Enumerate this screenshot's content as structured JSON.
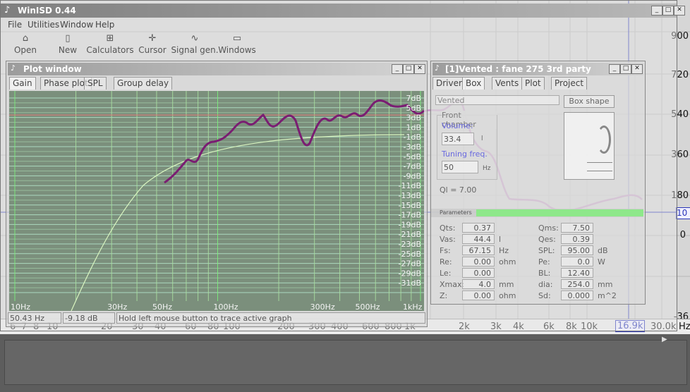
{
  "app": {
    "title": "WinISD 0.44",
    "menu": [
      "File",
      "Utilities",
      "Window",
      "Help"
    ],
    "toolbar": [
      {
        "label": "Open",
        "icon": "open-folder-icon"
      },
      {
        "label": "New",
        "icon": "new-document-icon"
      },
      {
        "label": "Calculators",
        "icon": "calculator-icon"
      },
      {
        "label": "Cursor",
        "icon": "cursor-icon"
      },
      {
        "label": "Signal gen.",
        "icon": "signal-generator-icon"
      },
      {
        "label": "Windows",
        "icon": "windows-icon"
      }
    ]
  },
  "background_graph": {
    "freq_labels": [
      "6",
      "7",
      "8",
      "10",
      "20",
      "30",
      "40",
      "60",
      "80",
      "100",
      "200",
      "300",
      "400",
      "600",
      "800",
      "1k",
      "2k",
      "3k",
      "4k",
      "6k",
      "8k",
      "10k",
      "16.9k",
      "30.0k",
      "Hz"
    ],
    "right_labels": [
      "900",
      "720",
      "540",
      "360",
      "180",
      "0",
      "-36",
      "10"
    ],
    "cursor_readout": "16.9k"
  },
  "plot_window": {
    "title": "Plot window",
    "tabs": [
      "Gain",
      "Phase plot",
      "SPL",
      "Group delay"
    ],
    "db_labels": [
      "7dB",
      "5dB",
      "3dB",
      "1dB",
      "-1dB",
      "-3dB",
      "-5dB",
      "-7dB",
      "-9dB",
      "-11dB",
      "-13dB",
      "-15dB",
      "-17dB",
      "-19dB",
      "-21dB",
      "-23dB",
      "-25dB",
      "-27dB",
      "-29dB",
      "-31dB"
    ],
    "freq_labels": [
      "10Hz",
      "30Hz",
      "50Hz",
      "100Hz",
      "300Hz",
      "500Hz",
      "1kHz"
    ],
    "status": {
      "freq": "50.43 Hz",
      "gain": "-9.18 dB",
      "hint": "Hold left mouse button to trace active graph"
    }
  },
  "box_window": {
    "title": "[1]Vented : fane 275 3rd party",
    "tabs": [
      "Driver",
      "Box",
      "Vents",
      "Plot",
      "Project"
    ],
    "box_type": "Vented",
    "box_shape_button": "Box shape",
    "front_chamber": "Front chamber",
    "volume_label": "Volume:",
    "volume_value": "33.4",
    "volume_unit": "l",
    "tuning_label": "Tuning freq.",
    "tuning_value": "50",
    "tuning_unit": "Hz",
    "ql": "Ql = 7.00",
    "parameters_label": "Parameters",
    "params_left": [
      {
        "name": "Qts:",
        "value": "0.37",
        "unit": ""
      },
      {
        "name": "Vas:",
        "value": "44.4",
        "unit": "l"
      },
      {
        "name": "Fs:",
        "value": "67.15",
        "unit": "Hz"
      },
      {
        "name": "Re:",
        "value": "0.00",
        "unit": "ohm"
      },
      {
        "name": "Le:",
        "value": "0.00",
        "unit": ""
      },
      {
        "name": "Xmax:",
        "value": "4.0",
        "unit": "mm"
      },
      {
        "name": "Z:",
        "value": "0.00",
        "unit": "ohm"
      }
    ],
    "params_right": [
      {
        "name": "Qms:",
        "value": "7.50",
        "unit": ""
      },
      {
        "name": "Qes:",
        "value": "0.39",
        "unit": ""
      },
      {
        "name": "SPL:",
        "value": "95.00",
        "unit": "dB"
      },
      {
        "name": "Pe:",
        "value": "0.0",
        "unit": "W"
      },
      {
        "name": "BL:",
        "value": "12.40",
        "unit": ""
      },
      {
        "name": "dia:",
        "value": "254.0",
        "unit": "mm"
      },
      {
        "name": "Sd:",
        "value": "0.000",
        "unit": "m^2"
      }
    ]
  },
  "colors": {
    "response_curve": "#7a1d72",
    "model_curve": "#d9f5c0",
    "grid_major": "#7cf07c",
    "grid_minor": "#b8ecd0",
    "cursor_line": "#2a35b8"
  }
}
